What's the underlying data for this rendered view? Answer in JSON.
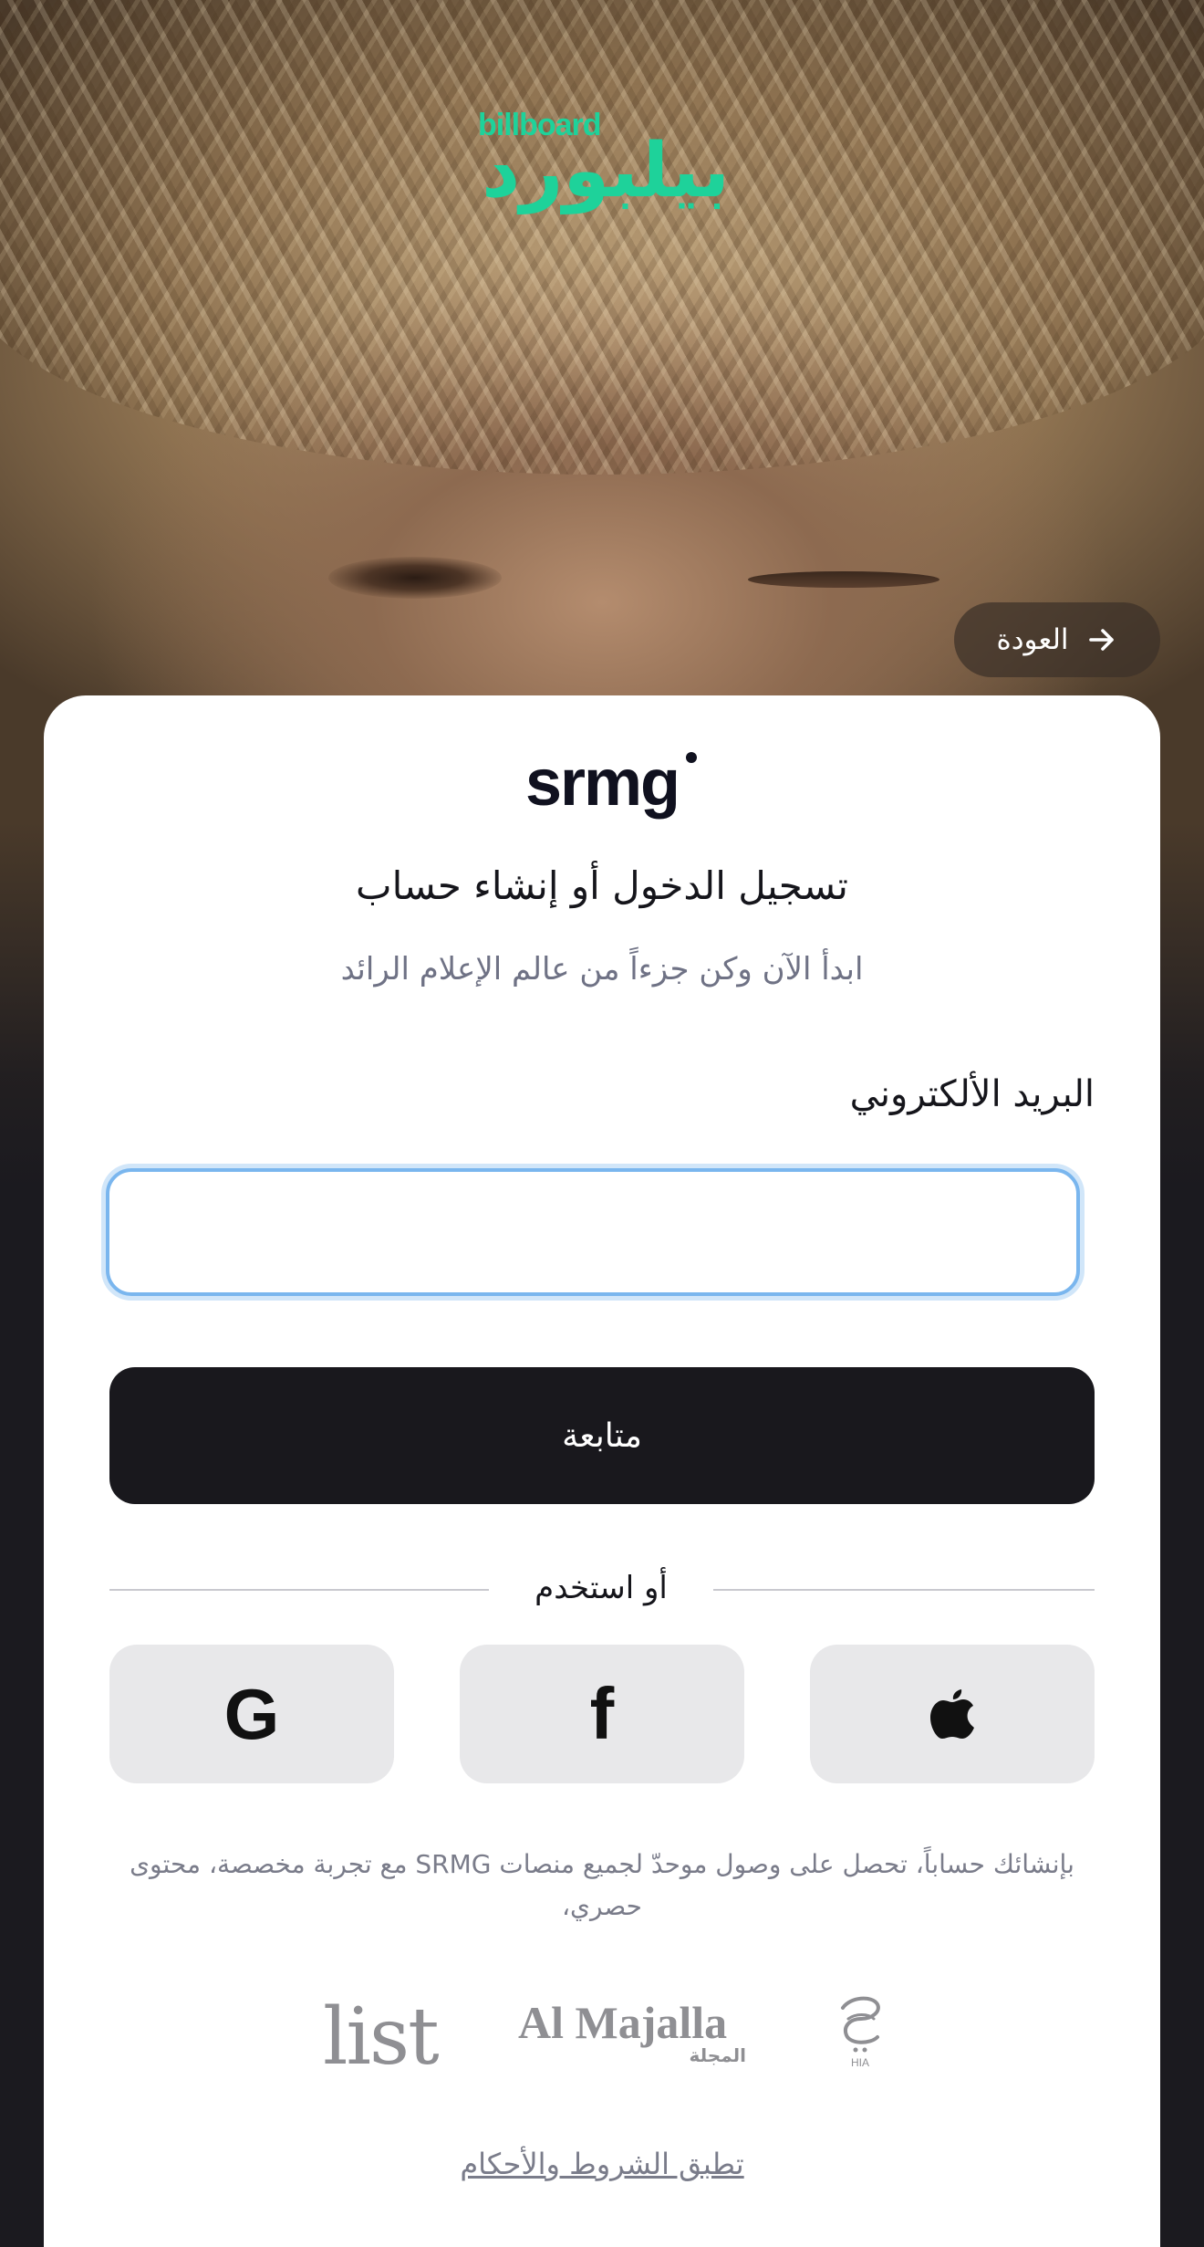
{
  "brand": {
    "logo_en": "billboard",
    "logo_ar": "بيلبورد",
    "accent_color": "#1ed29a"
  },
  "nav": {
    "back_label": "العودة",
    "back_icon": "arrow-right-icon"
  },
  "card": {
    "logo": "srmg",
    "title": "تسجيل الدخول أو إنشاء حساب",
    "subtitle": "ابدأ الآن وكن جزءاً من عالم الإعلام الرائد",
    "email_label": "البريد الألكتروني",
    "email_value": "",
    "continue_label": "متابعة",
    "or_use_label": "أو استخدم",
    "social": [
      {
        "name": "google",
        "icon": "google-icon",
        "glyph": "G"
      },
      {
        "name": "facebook",
        "icon": "facebook-icon",
        "glyph": "f"
      },
      {
        "name": "apple",
        "icon": "apple-icon"
      }
    ],
    "legal_text": "بإنشائك حساباً، تحصل على وصول موحدّ لجميع منصات SRMG مع تجربة مخصصة، محتوى حصري،",
    "partners": {
      "list": "list",
      "majalla_en": "Al Majalla",
      "majalla_ar": "المجلة",
      "hia": "HIA"
    },
    "terms_link": "تطبق الشروط والأحكام"
  },
  "colors": {
    "primary_button": "#19181d",
    "input_focus": "#7ab6ee",
    "social_bg": "#e8e8ea"
  }
}
